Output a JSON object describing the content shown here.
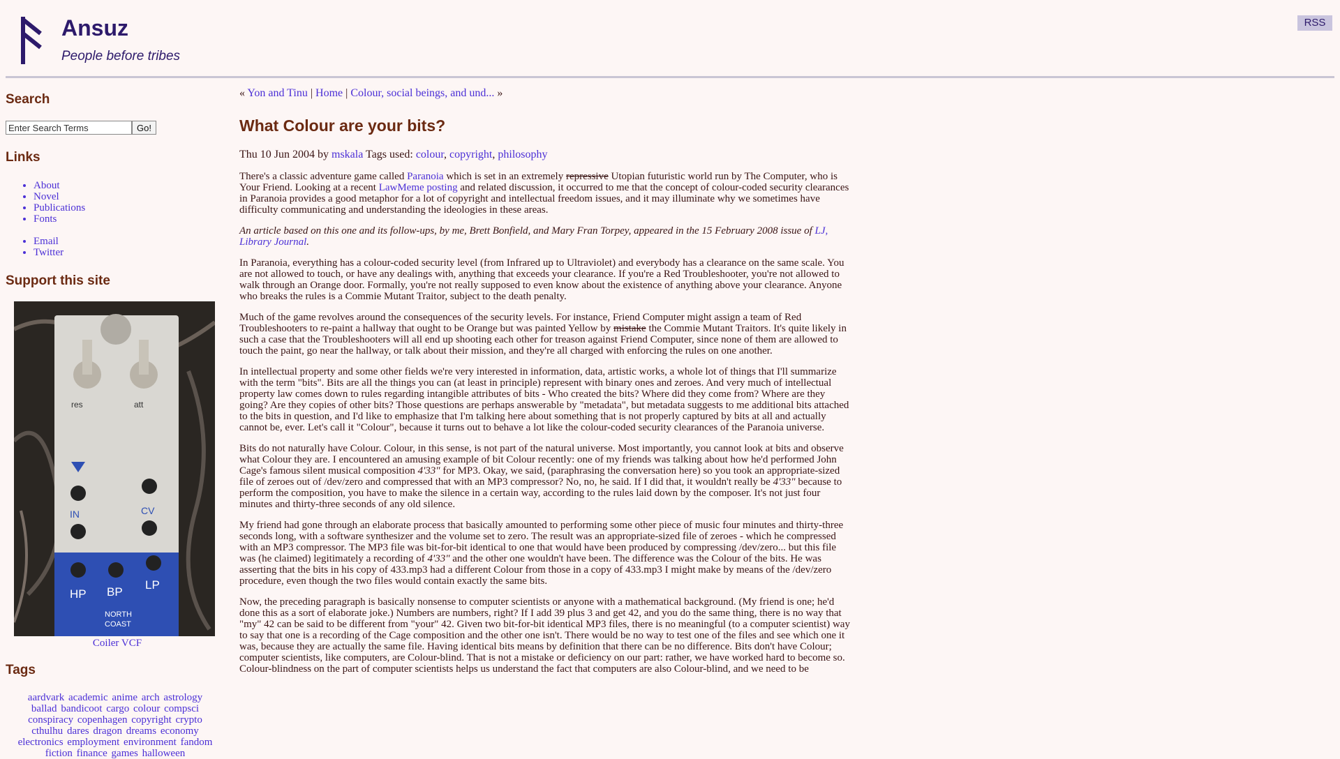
{
  "site": {
    "title": "Ansuz",
    "tagline": "People before tribes",
    "rss": "RSS"
  },
  "sidebar": {
    "search_heading": "Search",
    "search_placeholder": "Enter Search Terms",
    "search_button": "Go!",
    "links_heading": "Links",
    "links_primary": [
      "About",
      "Novel",
      "Publications",
      "Fonts"
    ],
    "links_secondary": [
      "Email",
      "Twitter"
    ],
    "support_heading": "Support this site",
    "support_caption": "Coiler VCF",
    "tags_heading": "Tags",
    "tags": [
      "aardvark",
      "academic",
      "anime",
      "arch",
      "astrology",
      "ballad",
      "bandicoot",
      "cargo",
      "colour",
      "compsci",
      "conspiracy",
      "copenhagen",
      "copyright",
      "crypto",
      "cthulhu",
      "dares",
      "dragon",
      "dreams",
      "economy",
      "electronics",
      "employment",
      "environment",
      "fandom",
      "fiction",
      "finance",
      "games",
      "halloween"
    ]
  },
  "post": {
    "nav_prev": "Yon and Tinu",
    "nav_home": "Home",
    "nav_next": "Colour, social beings, and und...",
    "nav_prev_mark": "«",
    "nav_next_mark": "»",
    "nav_sep": "|",
    "title": "What Colour are your bits?",
    "date_by": "Thu 10 Jun 2004 by",
    "author": "mskala",
    "tags_label": "Tags used:",
    "tags": [
      "colour",
      "copyright",
      "philosophy"
    ],
    "p1_a": "There's a classic adventure game called ",
    "p1_link1": "Paranoia",
    "p1_b": " which is set in an extremely ",
    "p1_strike": "repressive",
    "p1_c": " Utopian futuristic world run by The Computer, who is Your Friend.  Looking at a recent ",
    "p1_link2": "LawMeme posting",
    "p1_d": " and related discussion, it occurred to me that the concept of colour-coded security clearances in Paranoia provides a good metaphor for a lot of copyright and intellectual freedom issues, and it may illuminate why we sometimes have difficulty communicating and understanding the ideologies in these areas.",
    "p2_a": "An article based on this one and its follow-ups, by me, Brett Bonfield, and Mary Fran Torpey, appeared in the 15 February 2008 issue of ",
    "p2_link": "LJ, Library Journal",
    "p2_b": ".",
    "p3": "In Paranoia, everything has a colour-coded security level (from Infrared up to Ultraviolet) and everybody has a clearance on the same scale.  You are not allowed to touch, or have any dealings with, anything that exceeds your clearance.  If you're a Red Troubleshooter, you're not allowed to walk through an Orange door.  Formally, you're not really supposed to even know about the existence of anything above your clearance.  Anyone who breaks the rules is a Commie Mutant Traitor, subject to the death penalty.",
    "p4_a": "Much of the game revolves around the consequences of the security levels.  For instance, Friend Computer might assign a team of Red Troubleshooters to re-paint a hallway that ought to be Orange but was painted Yellow by ",
    "p4_strike": "mistake",
    "p4_b": " the Commie Mutant Traitors.  It's quite likely in such a case that the Troubleshooters will all end up shooting each other for treason against Friend Computer, since none of them are allowed to touch the paint, go near the hallway, or talk about their mission, and they're all charged with enforcing the rules on one another.",
    "p5": "In intellectual property and some other fields we're very interested in information, data, artistic works, a whole lot of things that I'll summarize with the term \"bits\".  Bits are all the things you can (at least in principle) represent with binary ones and zeroes.  And very much of intellectual property law comes down to rules regarding intangible attributes of bits - Who created the bits?  Where did they come from?  Where are they going?  Are they copies of other bits?  Those questions are perhaps answerable by \"metadata\", but metadata suggests to me additional bits attached to the bits in question, and I'd like to emphasize that I'm talking here about something that is not properly captured by bits at all and actually cannot be, ever.  Let's call it \"Colour\", because it turns out to behave a lot like the colour-coded security clearances of the Paranoia universe.",
    "p6_a": "Bits do not naturally have Colour.  Colour, in this sense, is not part of the natural universe.  Most importantly, you cannot look at bits and observe what Colour they are.  I encountered an amusing example of bit Colour recently:  one of my friends was talking about how he'd performed John Cage's famous silent musical composition ",
    "p6_em1": "4'33\"",
    "p6_b": " for MP3.  Okay, we said, (paraphrasing the conversation here) so you took an appropriate-sized file of zeroes out of /dev/zero and compressed that with an MP3 compressor?  No, no, he said.  If I did that, it wouldn't really be ",
    "p6_em2": "4'33\"",
    "p6_c": " because to perform the composition, you have to make the silence in a certain way, according to the rules laid down by the composer.  It's not just four minutes and thirty-three seconds of any old silence.",
    "p7_a": "My friend had gone through an elaborate process that basically amounted to performing some other piece of music four minutes and thirty-three seconds long, with a software synthesizer and the volume set to zero.  The result was an appropriate-sized file of zeroes - which he compressed with an MP3 compressor.  The MP3 file was bit-for-bit identical to one that would have been produced by compressing /dev/zero...  but this file was (he claimed) legitimately a recording of ",
    "p7_em": "4'33\"",
    "p7_b": " and the other one wouldn't have been.  The difference was the Colour of the bits.  He was asserting that the bits in his copy of 433.mp3 had a different Colour from those in a copy of 433.mp3 I might make by means of the /dev/zero procedure, even though the two files would contain exactly the same bits.",
    "p8": "Now, the preceding paragraph is basically nonsense to computer scientists or anyone with a mathematical background.  (My friend is one; he'd done this as a sort of elaborate joke.) Numbers are numbers, right?  If I add 39 plus 3 and get 42, and you do the same thing, there is no way that \"my\" 42 can be said to be different from \"your\" 42.  Given two bit-for-bit identical MP3 files, there is no meaningful (to a computer scientist) way to say that one is a recording of the Cage composition and the other one isn't.  There would be no way to test one of the files and see which one it was, because they are actually the same file.  Having identical bits means by definition that there can be no difference.  Bits don't have Colour; computer scientists, like computers, are Colour-blind.  That is not a mistake or deficiency on our part:  rather, we have worked hard to become so.  Colour-blindness on the part of computer scientists helps us understand the fact that computers are also Colour-blind, and we need to be"
  },
  "colors": {
    "background": "#fdf6f5",
    "link": "#4b2fd6",
    "heading": "#6b2a12",
    "site_title": "#2d1a6b"
  }
}
